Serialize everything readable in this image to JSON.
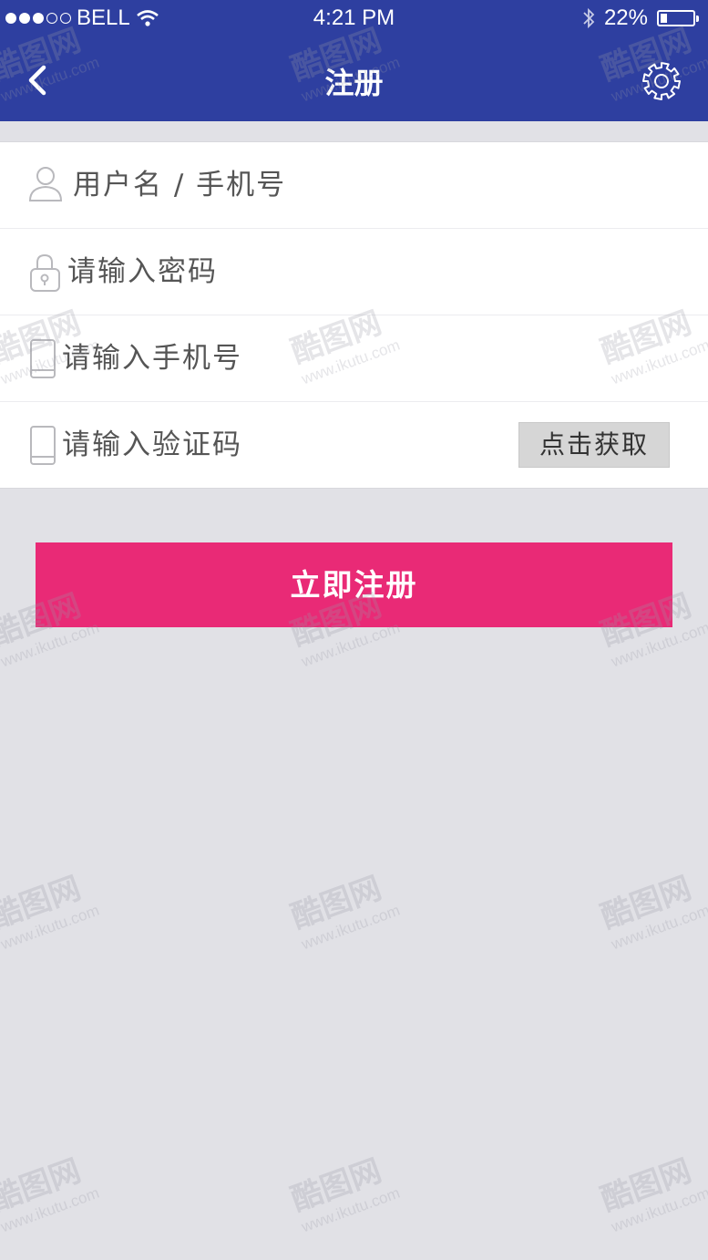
{
  "status_bar": {
    "carrier": "BELL",
    "time": "4:21 PM",
    "battery": "22%",
    "battery_level": 0.22,
    "signal_icon": "signal-dots-icon",
    "wifi_icon": "wifi-icon",
    "bluetooth_icon": "bluetooth-icon"
  },
  "nav": {
    "title": "注册",
    "back_icon": "chevron-left-icon",
    "settings_icon": "gear-icon",
    "color": "#2e3fa0"
  },
  "form": {
    "username_placeholder": "用户名 / 手机号",
    "password_placeholder": "请输入密码",
    "phone_placeholder": "请输入手机号",
    "code_placeholder": "请输入验证码",
    "get_code_label": "点击获取",
    "icons": [
      "user-icon",
      "lock-icon",
      "phone-icon",
      "phone-icon"
    ]
  },
  "submit": {
    "label": "立即注册",
    "color": "#e92a76"
  },
  "watermark": {
    "brand": "酷图网",
    "url": "www.ikutu.com"
  }
}
